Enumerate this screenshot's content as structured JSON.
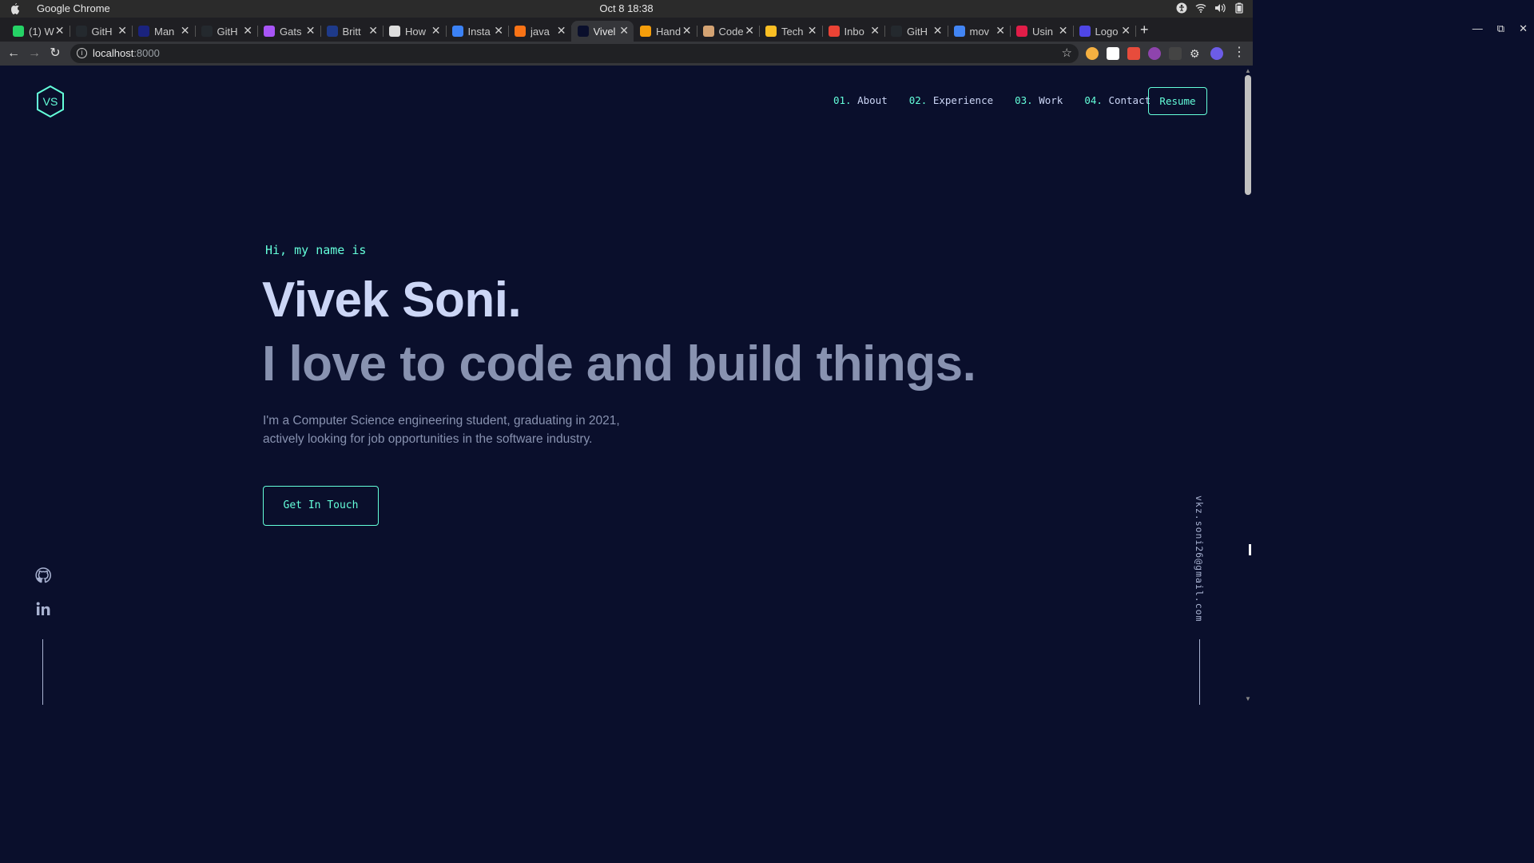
{
  "os": {
    "app_name": "Google Chrome",
    "clock": "Oct 8  18:38"
  },
  "tabs": [
    {
      "title": "(1) W",
      "color": "#25d366"
    },
    {
      "title": "GitH",
      "color": "#24292e"
    },
    {
      "title": "Man",
      "color": "#1a237e"
    },
    {
      "title": "GitH",
      "color": "#24292e"
    },
    {
      "title": "Gats",
      "color": "#a855f7"
    },
    {
      "title": "Britt",
      "color": "#1e3a8a"
    },
    {
      "title": "How",
      "color": "#dddddd"
    },
    {
      "title": "Insta",
      "color": "#3b82f6"
    },
    {
      "title": "java",
      "color": "#f97316"
    },
    {
      "title": "Vivel",
      "color": "#0a0f2c",
      "active": true
    },
    {
      "title": "Hand",
      "color": "#f59e0b"
    },
    {
      "title": "Code",
      "color": "#d4a373"
    },
    {
      "title": "Tech",
      "color": "#fbbf24"
    },
    {
      "title": "Inbo",
      "color": "#ea4335"
    },
    {
      "title": "GitH",
      "color": "#24292e"
    },
    {
      "title": "mov",
      "color": "#4285f4"
    },
    {
      "title": "Usin",
      "color": "#e11d48"
    },
    {
      "title": "Logo",
      "color": "#4f46e5"
    }
  ],
  "address": {
    "host": "localhost",
    "port": ":8000"
  },
  "site": {
    "logo_text": "VS",
    "nav": [
      {
        "num": "01.",
        "label": "About"
      },
      {
        "num": "02.",
        "label": "Experience"
      },
      {
        "num": "03.",
        "label": "Work"
      },
      {
        "num": "04.",
        "label": "Contact"
      }
    ],
    "resume_label": "Resume",
    "greeting": "Hi, my name is",
    "name": "Vivek Soni.",
    "tagline": "I love to code and build things.",
    "intro": "I'm a Computer Science engineering student, graduating in 2021, actively looking for job opportunities in the software industry.",
    "cta_label": "Get In Touch",
    "email": "vkz.soni26@gmail.com",
    "social": [
      "github-icon",
      "linkedin-icon"
    ]
  },
  "colors": {
    "background": "#0a0f2c",
    "accent": "#64ffda",
    "heading": "#ccd6f6",
    "muted": "#8892b0"
  }
}
